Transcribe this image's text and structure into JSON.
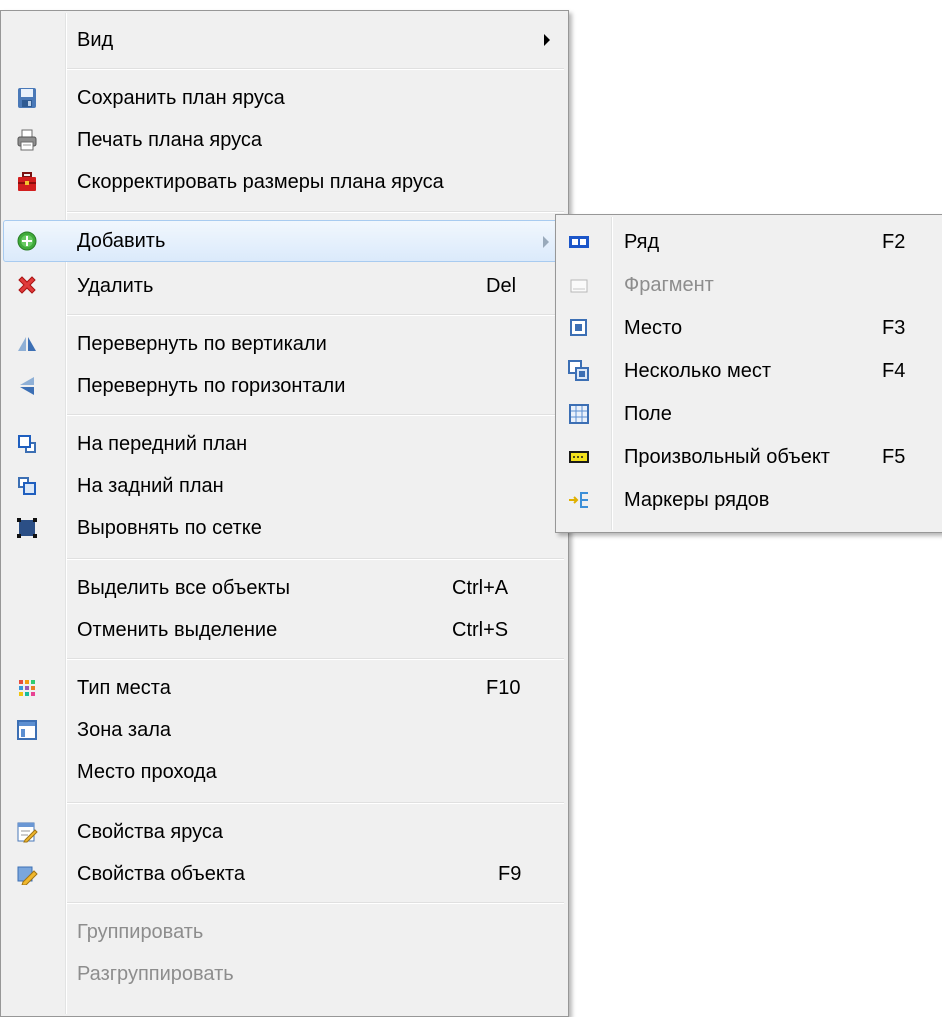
{
  "main_menu": {
    "view": {
      "label": "Вид"
    },
    "save_plan": {
      "label": "Сохранить план яруса",
      "icon": "save-icon"
    },
    "print_plan": {
      "label": "Печать плана яруса",
      "icon": "printer-icon"
    },
    "adjust_size": {
      "label": "Скорректировать размеры плана яруса",
      "icon": "toolbox-icon"
    },
    "add": {
      "label": "Добавить",
      "icon": "add-icon"
    },
    "delete": {
      "label": "Удалить",
      "shortcut": "Del",
      "icon": "delete-icon"
    },
    "flip_vertical": {
      "label": "Перевернуть по вертикали",
      "icon": "flip-vertical-icon"
    },
    "flip_horizontal": {
      "label": "Перевернуть по горизонтали",
      "icon": "flip-horizontal-icon"
    },
    "bring_front": {
      "label": "На передний план",
      "icon": "bring-front-icon"
    },
    "send_back": {
      "label": "На задний план",
      "icon": "send-back-icon"
    },
    "align_grid": {
      "label": "Выровнять по сетке",
      "icon": "align-grid-icon"
    },
    "select_all": {
      "label": "Выделить все объекты",
      "shortcut": "Ctrl+A"
    },
    "deselect": {
      "label": "Отменить выделение",
      "shortcut": "Ctrl+S"
    },
    "seat_type": {
      "label": "Тип места",
      "shortcut": "F10",
      "icon": "seat-type-icon"
    },
    "hall_zone": {
      "label": "Зона зала",
      "icon": "hall-zone-icon"
    },
    "aisle": {
      "label": "Место прохода"
    },
    "tier_props": {
      "label": "Свойства яруса",
      "icon": "tier-properties-icon"
    },
    "object_props": {
      "label": "Свойства объекта",
      "shortcut": "F9",
      "icon": "object-properties-icon"
    },
    "group": {
      "label": "Группировать"
    },
    "ungroup": {
      "label": "Разгруппировать"
    }
  },
  "add_submenu": {
    "row": {
      "label": "Ряд",
      "shortcut": "F2",
      "icon": "row-icon"
    },
    "fragment": {
      "label": "Фрагмент",
      "icon": "fragment-icon"
    },
    "seat": {
      "label": "Место",
      "shortcut": "F3",
      "icon": "seat-icon"
    },
    "multi_seats": {
      "label": "Несколько мест",
      "shortcut": "F4",
      "icon": "multiple-seats-icon"
    },
    "field": {
      "label": "Поле",
      "icon": "field-icon"
    },
    "custom_object": {
      "label": "Произвольный объект",
      "shortcut": "F5",
      "icon": "custom-object-icon"
    },
    "row_markers": {
      "label": "Маркеры рядов",
      "icon": "row-markers-icon"
    }
  },
  "colors": {
    "menu_bg": "#f0f0f0",
    "hover_border": "#a8cbf0",
    "disabled_text": "#8d8d8d"
  }
}
